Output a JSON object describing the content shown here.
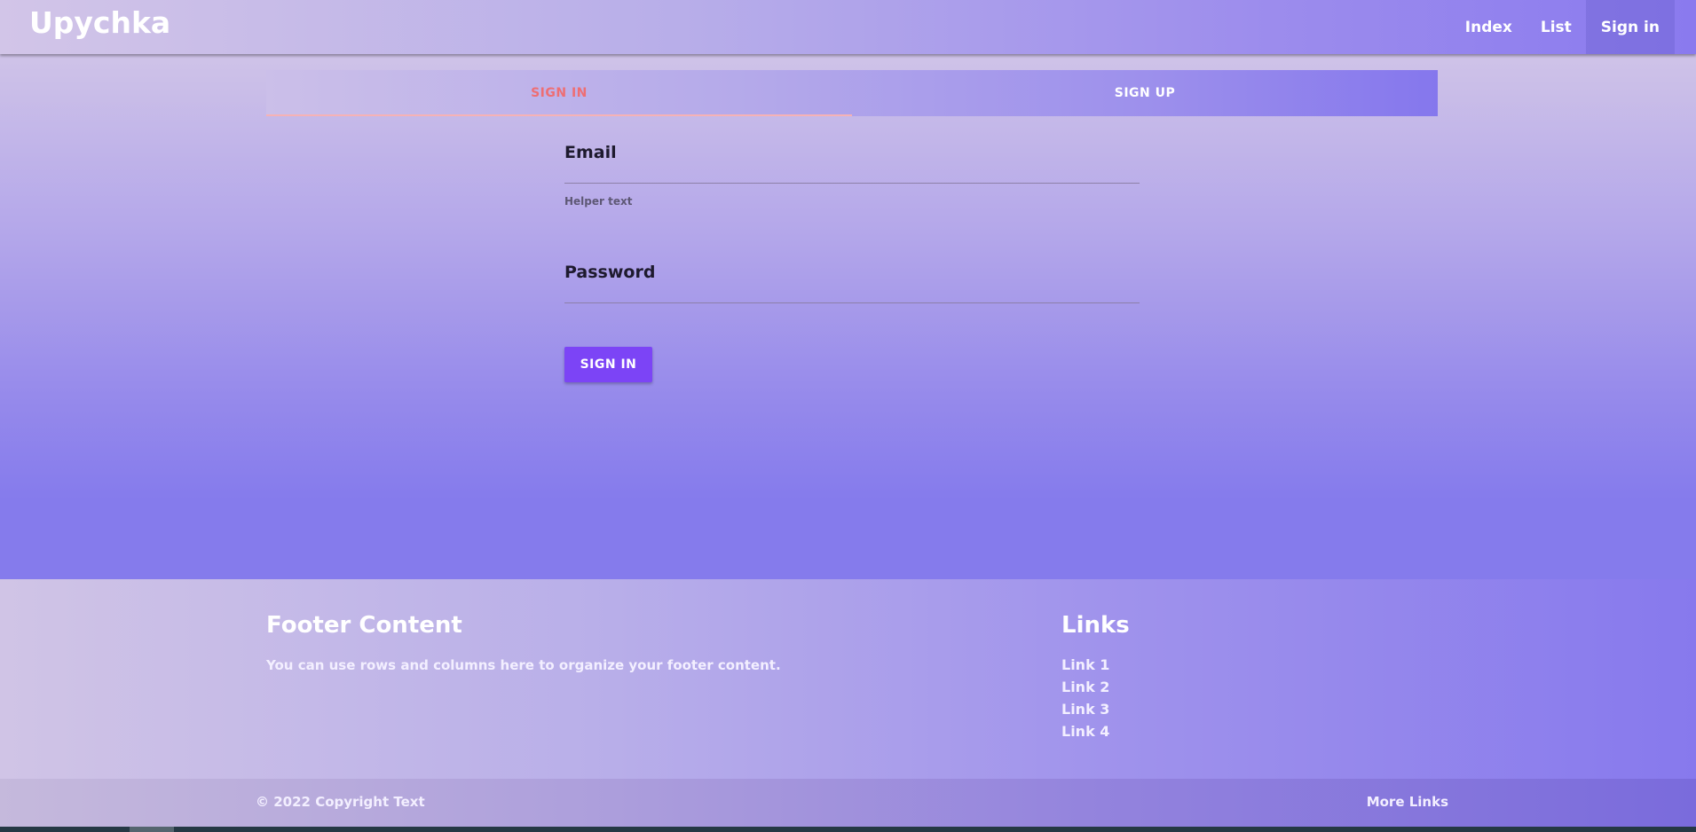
{
  "navbar": {
    "brand": "Upychka",
    "links": [
      {
        "label": "Index"
      },
      {
        "label": "List"
      },
      {
        "label": "Sign in",
        "active": true
      }
    ]
  },
  "tabs": [
    {
      "label": "SIGN IN",
      "active": true
    },
    {
      "label": "SIGN UP",
      "active": false
    }
  ],
  "form": {
    "email": {
      "label": "Email",
      "helper": "Helper text",
      "value": ""
    },
    "password": {
      "label": "Password",
      "value": ""
    },
    "submit_label": "SIGN IN"
  },
  "footer": {
    "title": "Footer Content",
    "text": "You can use rows and columns here to organize your footer content.",
    "links_title": "Links",
    "links": [
      "Link 1",
      "Link 2",
      "Link 3",
      "Link 4"
    ],
    "copyright": "© 2022 Copyright Text",
    "more_links": "More Links"
  },
  "colors": {
    "accent": "#7c44f6",
    "active_tab_text": "#ee6e73",
    "gradient_start": "#d2c5e8",
    "gradient_end": "#8577ed"
  }
}
